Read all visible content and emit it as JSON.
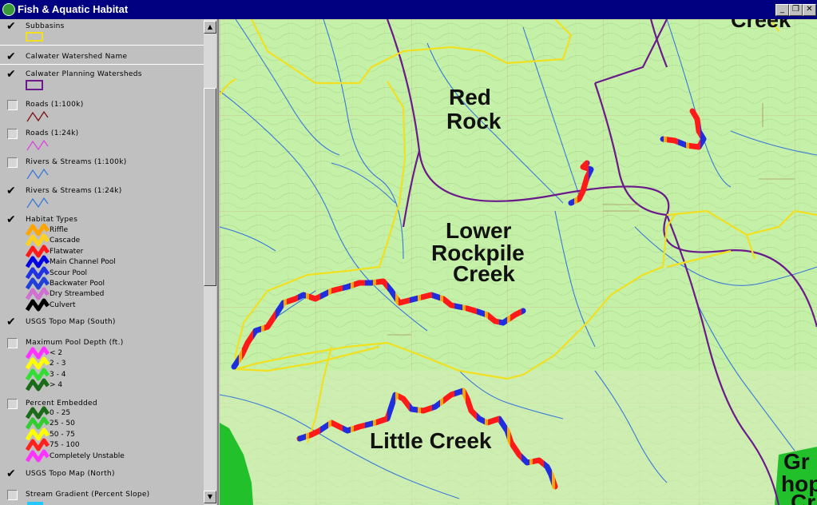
{
  "window": {
    "title": "Fish & Aquatic Habitat",
    "minimize": "_",
    "restore": "❐",
    "close": "✕"
  },
  "legend": {
    "layers": [
      {
        "id": "subbasins",
        "label": "Subbasins",
        "checked": true
      },
      {
        "id": "calwater-name",
        "label": "Calwater Watershed Name",
        "checked": true
      },
      {
        "id": "calwater-planning",
        "label": "Calwater Planning Watersheds",
        "checked": true
      },
      {
        "id": "roads-100k",
        "label": "Roads (1:100k)",
        "checked": false
      },
      {
        "id": "roads-24k",
        "label": "Roads (1:24k)",
        "checked": false
      },
      {
        "id": "rivers-100k",
        "label": "Rivers & Streams (1:100k)",
        "checked": false
      },
      {
        "id": "rivers-24k",
        "label": "Rivers & Streams (1:24k)",
        "checked": true
      },
      {
        "id": "habitat-types",
        "label": "Habitat Types",
        "checked": true
      },
      {
        "id": "usgs-south",
        "label": "USGS Topo Map (South)",
        "checked": true
      },
      {
        "id": "max-pool-depth",
        "label": "Maximum Pool Depth (ft.)",
        "checked": false
      },
      {
        "id": "percent-embedded",
        "label": "Percent Embedded",
        "checked": false
      },
      {
        "id": "usgs-north",
        "label": "USGS Topo Map (North)",
        "checked": true
      },
      {
        "id": "stream-gradient",
        "label": "Stream Gradient (Percent Slope)",
        "checked": false
      }
    ],
    "habitat_classes": [
      {
        "label": "Riffle",
        "color": "#ffa500"
      },
      {
        "label": "Cascade",
        "color": "#ffd21e"
      },
      {
        "label": "Flatwater",
        "color": "#ff1a1a"
      },
      {
        "label": "Main Channel Pool",
        "color": "#0000e0"
      },
      {
        "label": "Scour Pool",
        "color": "#1f33e0"
      },
      {
        "label": "Backwater Pool",
        "color": "#2140d8"
      },
      {
        "label": "Dry Streambed",
        "color": "#d070d0"
      },
      {
        "label": "Culvert",
        "color": "#000000"
      }
    ],
    "pool_depth_classes": [
      {
        "label": "< 2",
        "color": "#ff33ff"
      },
      {
        "label": "2 - 3",
        "color": "#ffff00"
      },
      {
        "label": "3 - 4",
        "color": "#33dd33"
      },
      {
        "label": "> 4",
        "color": "#1a6b1a"
      }
    ],
    "embedded_classes": [
      {
        "label": "0 - 25",
        "color": "#1a6b1a"
      },
      {
        "label": "25 - 50",
        "color": "#33cc33"
      },
      {
        "label": "50 - 75",
        "color": "#ffff00"
      },
      {
        "label": "75 - 100",
        "color": "#ff2020"
      },
      {
        "label": "Completely Unstable",
        "color": "#ff33ff"
      }
    ]
  },
  "map": {
    "labels": {
      "creek_top": "Creek",
      "red_rock_1": "Red",
      "red_rock_2": "Rock",
      "lower_1": "Lower",
      "lower_2": "Rockpile",
      "lower_3": "Creek",
      "little_creek": "Little Creek",
      "gr": "Gr",
      "hop": "hop",
      "cr": "Cr"
    },
    "colors": {
      "topo_bg": "#c5f0a8",
      "subbasin": "#f0e020",
      "planning": "#6a1a8a",
      "streams": "#3a78d8",
      "forest": "#22c02a"
    }
  }
}
